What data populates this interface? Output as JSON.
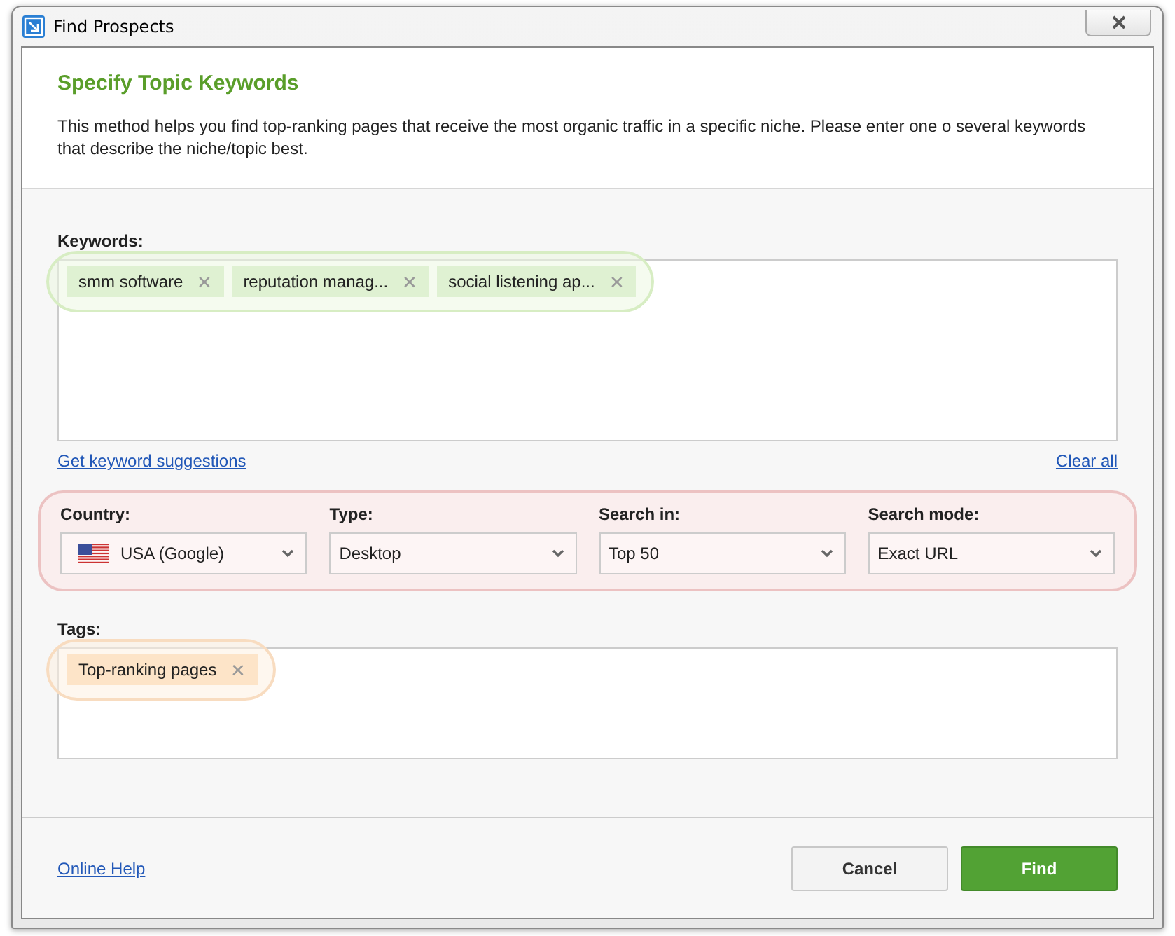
{
  "window": {
    "title": "Find Prospects"
  },
  "header": {
    "title": "Specify Topic Keywords",
    "description": "This method helps you find top-ranking pages that receive the most organic traffic in a specific niche. Please enter one o several keywords that describe the niche/topic best."
  },
  "keywords": {
    "label": "Keywords:",
    "chips": [
      {
        "text": "smm software",
        "remove": "✕"
      },
      {
        "text": "reputation manag...",
        "remove": "✕"
      },
      {
        "text": "social listening ap...",
        "remove": "✕"
      }
    ],
    "suggestions_link": "Get keyword suggestions",
    "clear_link": "Clear all"
  },
  "filters": [
    {
      "label": "Country:",
      "value": "USA (Google)",
      "flag": true
    },
    {
      "label": "Type:",
      "value": "Desktop",
      "flag": false
    },
    {
      "label": "Search in:",
      "value": "Top 50",
      "flag": false
    },
    {
      "label": "Search mode:",
      "value": "Exact URL",
      "flag": false
    }
  ],
  "tags": {
    "label": "Tags:",
    "chips": [
      {
        "text": "Top-ranking pages",
        "remove": "✕"
      }
    ]
  },
  "footer": {
    "help_link": "Online Help",
    "buttons": [
      {
        "label": "Cancel",
        "kind": "secondary"
      },
      {
        "label": "Find",
        "kind": "primary"
      }
    ]
  }
}
